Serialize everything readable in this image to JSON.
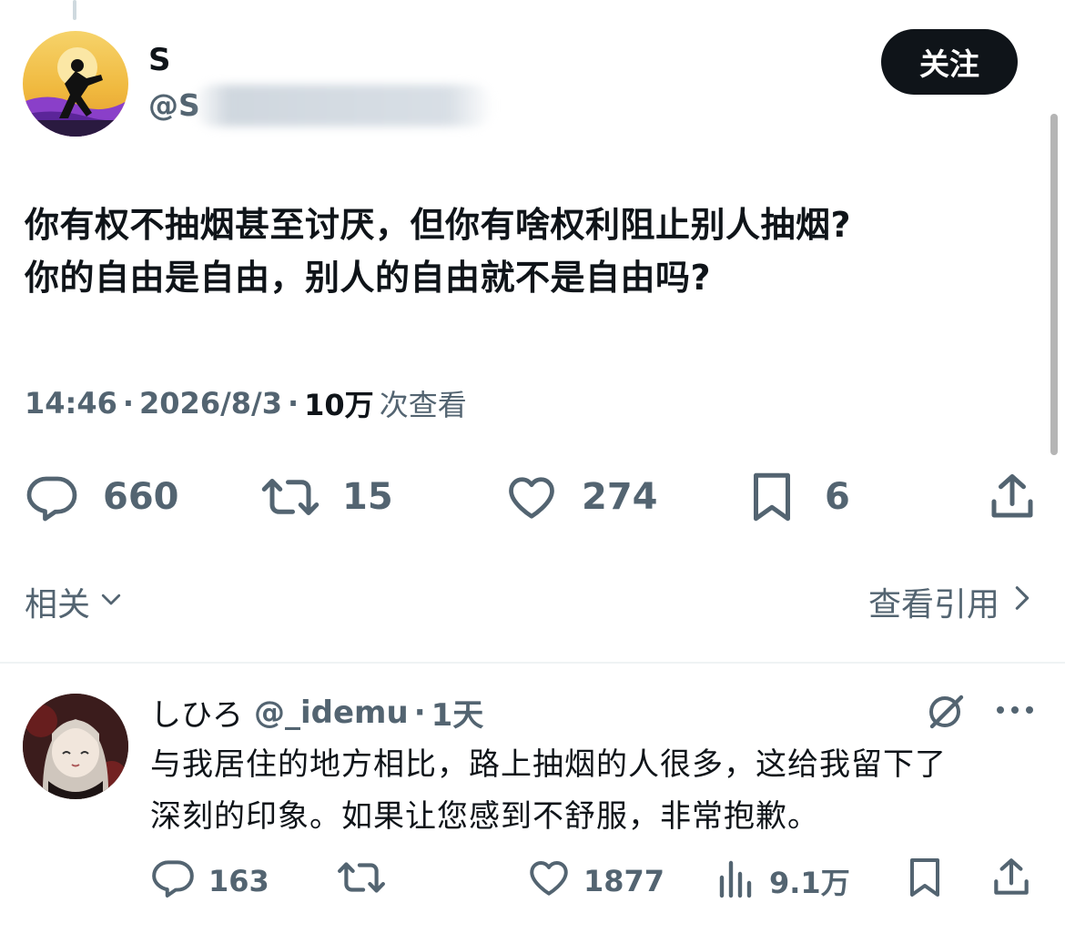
{
  "tweet": {
    "display_name": "S",
    "handle": "@S",
    "follow_label": "关注",
    "text_lines": [
      "你有权不抽烟甚至讨厌，但你有啥权利阻止别人抽烟?",
      "你的自由是自由，别人的自由就不是自由吗?"
    ],
    "time": "14:46",
    "date": "2026/8/3",
    "views_count": "10万",
    "views_label": "次查看",
    "sep": "·",
    "stats": {
      "replies": "660",
      "retweets": "15",
      "likes": "274",
      "bookmarks": "6"
    }
  },
  "nav": {
    "related_label": "相关",
    "view_quotes_label": "查看引用"
  },
  "reply": {
    "display_name": "しひろ",
    "handle": "@_idemu",
    "sep": "·",
    "time": "1天",
    "text_lines": [
      "与我居住的地方相比，路上抽烟的人很多，这给我留下了",
      "深刻的印象。如果让您感到不舒服，非常抱歉。"
    ],
    "stats": {
      "replies": "163",
      "likes": "1877",
      "views": "9.1万"
    }
  },
  "colors": {
    "text": "#0f1419",
    "secondary": "#536471",
    "follow_bg": "#0f1419"
  },
  "icons": [
    "reply-icon",
    "retweet-icon",
    "like-icon",
    "bookmark-icon",
    "share-icon",
    "chevron-down-icon",
    "chevron-right-icon",
    "grok-icon",
    "more-icon",
    "views-icon"
  ]
}
